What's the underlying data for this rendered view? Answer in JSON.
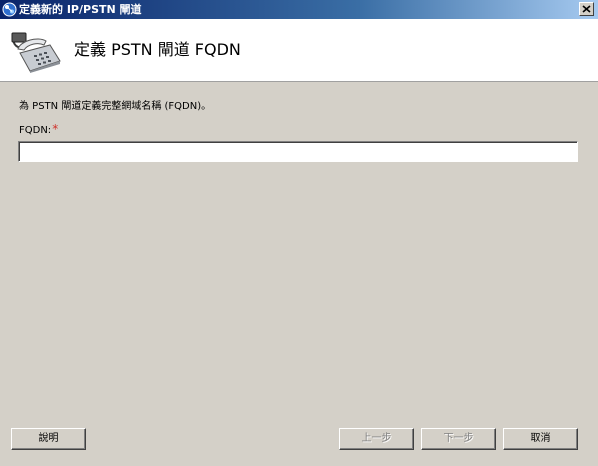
{
  "window": {
    "title": "定義新的 IP/PSTN 閘道",
    "title_icon": "topology-builder-icon",
    "close_icon": "close-x-icon"
  },
  "header": {
    "title": "定義 PSTN 閘道 FQDN",
    "icon": "telephone-gateway-icon"
  },
  "form": {
    "description": "為 PSTN 閘道定義完整網域名稱 (FQDN)。",
    "fqdn_label": "FQDN:",
    "required_marker": "*",
    "fqdn_value": "",
    "fqdn_placeholder": ""
  },
  "buttons": {
    "help": "說明",
    "back": "上一步",
    "next": "下一步",
    "cancel": "取消"
  },
  "colors": {
    "title_gradient_start": "#0a246a",
    "title_gradient_end": "#a6caf0",
    "dialog_background": "#d4d0c8",
    "header_background": "#ffffff",
    "required_marker": "#d0302a",
    "disabled_text": "#808080"
  }
}
